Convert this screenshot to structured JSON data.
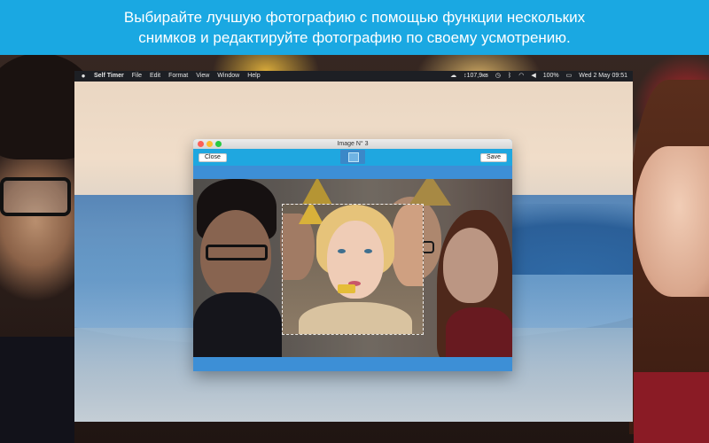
{
  "caption": {
    "line1": "Выбирайте лучшую фотографию с помощью функции нескольких",
    "line2": "снимков и редактируйте фотографию по своему усмотрению."
  },
  "menubar": {
    "apple_icon": "apple-logo",
    "app_name": "Self Timer",
    "items": [
      "File",
      "Edit",
      "Format",
      "View",
      "Window",
      "Help"
    ],
    "status": {
      "data_counter": "↕107,9кв",
      "battery": "100%",
      "date_time": "Wed 2 May  09:51"
    }
  },
  "window": {
    "title": "Image N° 3",
    "close_label": "Close",
    "save_label": "Save",
    "center_icon": "crop-photo-icon"
  },
  "colors": {
    "banner": "#1aa8e2",
    "toolbar": "#1fa7e0",
    "window_frame": "#3d8fd6"
  }
}
